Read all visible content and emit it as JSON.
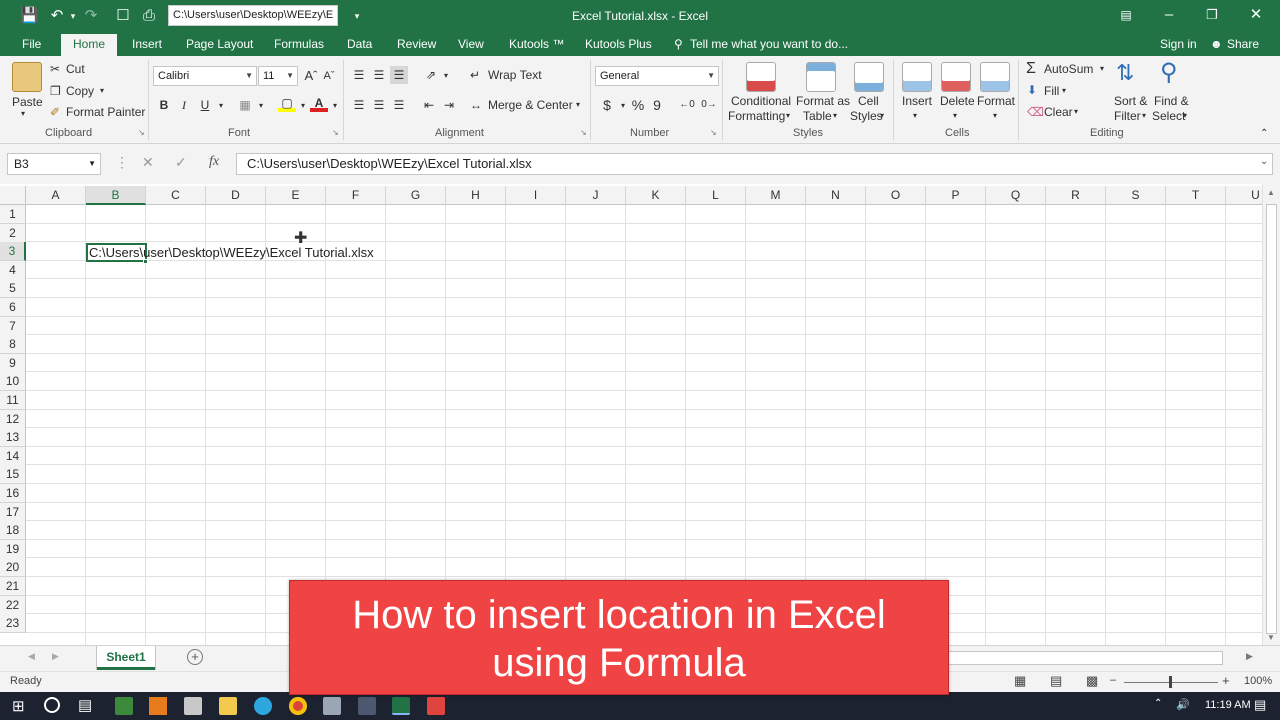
{
  "titlebar": {
    "path_box": "C:\\Users\\user\\Desktop\\WEEzy\\E",
    "window_title": "Excel Tutorial.xlsx  -  Excel"
  },
  "tabs": {
    "file": "File",
    "home": "Home",
    "insert": "Insert",
    "page_layout": "Page Layout",
    "formulas": "Formulas",
    "data": "Data",
    "review": "Review",
    "view": "View",
    "kutools": "Kutools ™",
    "kutools_plus": "Kutools Plus",
    "tell_me": "Tell me what you want to do...",
    "sign_in": "Sign in",
    "share": "Share"
  },
  "ribbon": {
    "clipboard": {
      "paste": "Paste",
      "cut": "Cut",
      "copy": "Copy",
      "format_painter": "Format Painter",
      "group": "Clipboard"
    },
    "font": {
      "name": "Calibri",
      "size": "11",
      "group": "Font",
      "bold": "B",
      "italic": "I",
      "underline": "U"
    },
    "alignment": {
      "wrap_text": "Wrap Text",
      "merge_center": "Merge & Center",
      "group": "Alignment"
    },
    "number": {
      "format": "General",
      "currency": "$",
      "percent": "%",
      "comma": "9",
      "group": "Number"
    },
    "styles": {
      "conditional1": "Conditional",
      "conditional2": "Formatting",
      "format_as1": "Format as",
      "format_as2": "Table",
      "cell1": "Cell",
      "cell2": "Styles",
      "group": "Styles"
    },
    "cells": {
      "insert": "Insert",
      "delete": "Delete",
      "format": "Format",
      "group": "Cells"
    },
    "editing": {
      "autosum": "AutoSum",
      "fill": "Fill",
      "clear": "Clear",
      "sort1": "Sort &",
      "sort2": "Filter",
      "find1": "Find &",
      "find2": "Select",
      "group": "Editing"
    }
  },
  "formula_bar": {
    "name_box": "B3",
    "fx": "fx",
    "formula": "C:\\Users\\user\\Desktop\\WEEzy\\Excel Tutorial.xlsx"
  },
  "grid": {
    "columns": [
      "A",
      "B",
      "C",
      "D",
      "E",
      "F",
      "G",
      "H",
      "I",
      "J",
      "K",
      "L",
      "M",
      "N",
      "O",
      "P",
      "Q",
      "R",
      "S",
      "T",
      "U"
    ],
    "rows": [
      "1",
      "2",
      "3",
      "4",
      "5",
      "6",
      "7",
      "8",
      "9",
      "10",
      "11",
      "12",
      "13",
      "14",
      "15",
      "16",
      "17",
      "18",
      "19",
      "20",
      "21",
      "22",
      "23"
    ],
    "selected_cell": "B3",
    "cell_b3": "C:\\Users\\user\\Desktop\\WEEzy\\Excel Tutorial.xlsx"
  },
  "sheets": {
    "active": "Sheet1"
  },
  "status": {
    "state": "Ready",
    "zoom": "100%"
  },
  "taskbar": {
    "time": "11:19 AM"
  },
  "overlay": {
    "line1": "How to insert location in Excel",
    "line2": "using Formula"
  },
  "colors": {
    "accent": "#217346",
    "overlay": "#f04444"
  }
}
